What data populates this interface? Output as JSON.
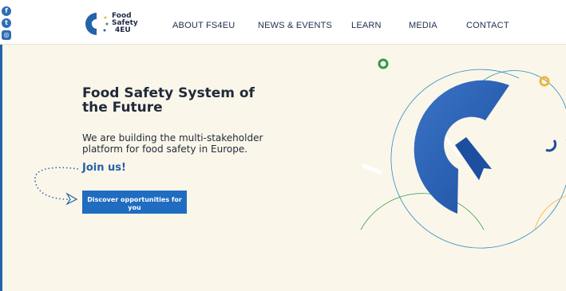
{
  "header": {
    "logo_lines": [
      "Food",
      "Safety",
      "4EU"
    ],
    "nav": [
      {
        "label": "ABOUT FS4EU"
      },
      {
        "label": "NEWS & EVENTS"
      },
      {
        "label": "LEARN"
      },
      {
        "label": "MEDIA"
      },
      {
        "label": "CONTACT"
      }
    ]
  },
  "social": [
    {
      "icon": "facebook-icon",
      "glyph": "f"
    },
    {
      "icon": "twitter-icon",
      "glyph": "t"
    },
    {
      "icon": "instagram-icon",
      "glyph": "◎"
    }
  ],
  "hero": {
    "title": "Food Safety System of the Future",
    "subtitle": "We are building the multi-stakeholder platform for food safety in Europe.",
    "join": "Join us!",
    "cta_label": "Discover opportunities for you"
  },
  "colors": {
    "brand_blue": "#1f6cc0",
    "dark_text": "#1f2a3a",
    "background": "#fbf6ea",
    "accent_green": "#2e9a46",
    "accent_yellow": "#f2b632"
  }
}
